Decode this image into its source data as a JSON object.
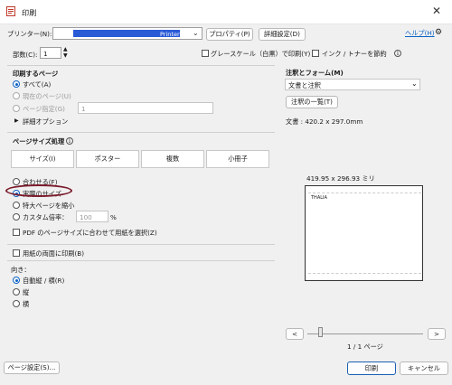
{
  "window": {
    "title": "印刷",
    "close_glyph": "✕"
  },
  "printer": {
    "label": "プリンター(N):",
    "value": "Printer",
    "properties_button": "プロパティ(P)",
    "advanced_button": "詳細設定(D)",
    "help_link": "ヘルプ(H)"
  },
  "copies": {
    "label": "部数(C):",
    "value": "1"
  },
  "options": {
    "grayscale": "グレースケール（白黒）で印刷(Y)",
    "save_ink": "インク / トナーを節約"
  },
  "pages_to_print": {
    "title": "印刷するページ",
    "all": "すべて(A)",
    "current": "現在のページ(U)",
    "pages": "ページ指定(G)",
    "pages_value": "1",
    "more_options": "詳細オプション",
    "expand_glyph": "▶"
  },
  "page_sizing": {
    "title": "ページサイズ処理",
    "tabs": [
      "サイズ(I)",
      "ポスター",
      "複数",
      "小冊子"
    ],
    "fit": "合わせる(F)",
    "actual": "実際のサイズ",
    "shrink": "特大ページを縮小",
    "custom": "カスタム倍率：",
    "custom_value": "100",
    "percent": "%",
    "choose_paper": "PDF のページサイズに合わせて用紙を選択(Z)"
  },
  "duplex": {
    "label": "用紙の両面に印刷(B)"
  },
  "orientation": {
    "title": "向き：",
    "auto": "自動縦 / 横(R)",
    "portrait": "縦",
    "landscape": "横"
  },
  "comments": {
    "title": "注釈とフォーム(M)",
    "value": "文書と注釈",
    "summary_button": "注釈の一覧(T)",
    "document_size": "文書 : 420.2 x 297.0mm"
  },
  "preview": {
    "size_label": "419.95 x 296.93 ミリ",
    "brand": "THALIA",
    "prev": "<",
    "next": ">",
    "page_count": "1 / 1 ページ"
  },
  "footer": {
    "page_setup": "ページ設定(S)...",
    "print": "印刷",
    "cancel": "キャンセル"
  },
  "colors": {
    "accent": "#0b62c4",
    "annotation_circle": "#7a1a2a",
    "redacted": "#2a5bd7"
  }
}
